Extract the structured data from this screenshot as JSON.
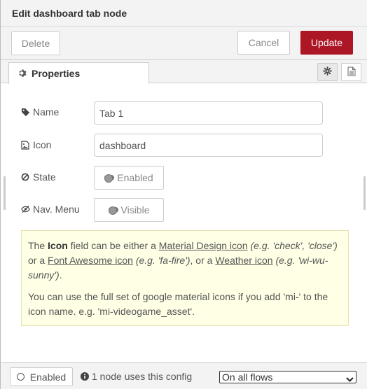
{
  "dialog": {
    "title": "Edit dashboard tab node"
  },
  "toolbar": {
    "delete_label": "Delete",
    "cancel_label": "Cancel",
    "update_label": "Update"
  },
  "tabs": {
    "properties_label": "Properties"
  },
  "form": {
    "name": {
      "label": "Name",
      "value": "Tab 1"
    },
    "icon": {
      "label": "Icon",
      "value": "dashboard"
    },
    "state": {
      "label": "State",
      "toggle_label": "Enabled"
    },
    "nav_menu": {
      "label": "Nav. Menu",
      "toggle_label": "Visible"
    }
  },
  "tip": {
    "p1_a": "The ",
    "p1_icon": "Icon",
    "p1_b": " field can be either a ",
    "p1_link1": "Material Design icon",
    "p1_eg1": " (e.g. 'check', 'close')",
    "p1_c": " or a ",
    "p1_link2": "Font Awesome icon",
    "p1_eg2": " (e.g. 'fa-fire')",
    "p1_d": ", or a ",
    "p1_link3": "Weather icon",
    "p1_eg3": " (e.g. 'wi-wu-sunny')",
    "p1_e": ".",
    "p2": "You can use the full set of google material icons if you add 'mi-' to the icon name. e.g. 'mi-videogame_asset'."
  },
  "footer": {
    "enabled_label": "Enabled",
    "users_text": "1 node uses this config",
    "scope_selected": "On all flows"
  }
}
